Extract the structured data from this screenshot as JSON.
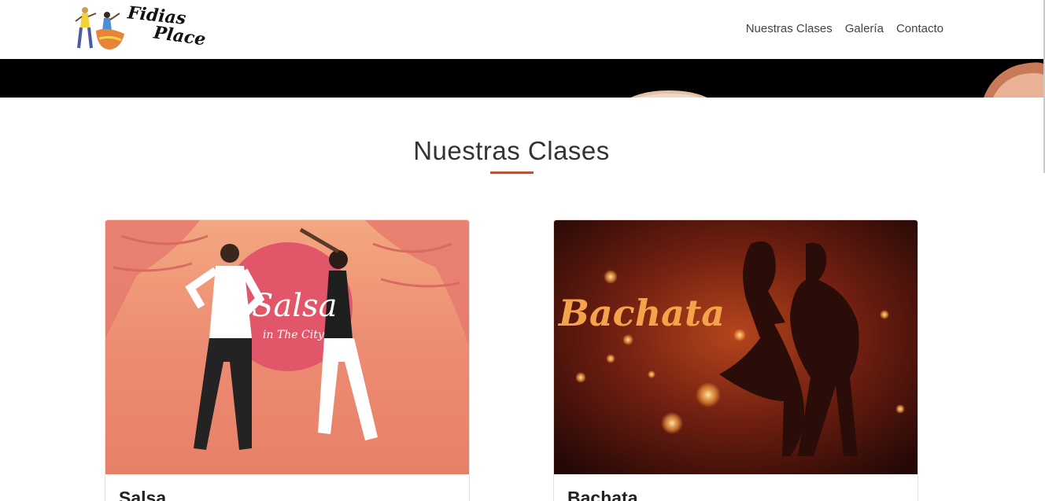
{
  "brand": {
    "line1": "Fidias",
    "line2": "Place"
  },
  "nav": {
    "items": [
      {
        "label": "Nuestras Clases"
      },
      {
        "label": "Galería"
      },
      {
        "label": "Contacto"
      }
    ]
  },
  "section": {
    "title": "Nuestras Clases",
    "accent_color": "#b4563b"
  },
  "cards": [
    {
      "title": "Salsa",
      "image_text": "Salsa",
      "image_subtext": "in The City"
    },
    {
      "title": "Bachata",
      "image_text": "Bachata"
    }
  ]
}
